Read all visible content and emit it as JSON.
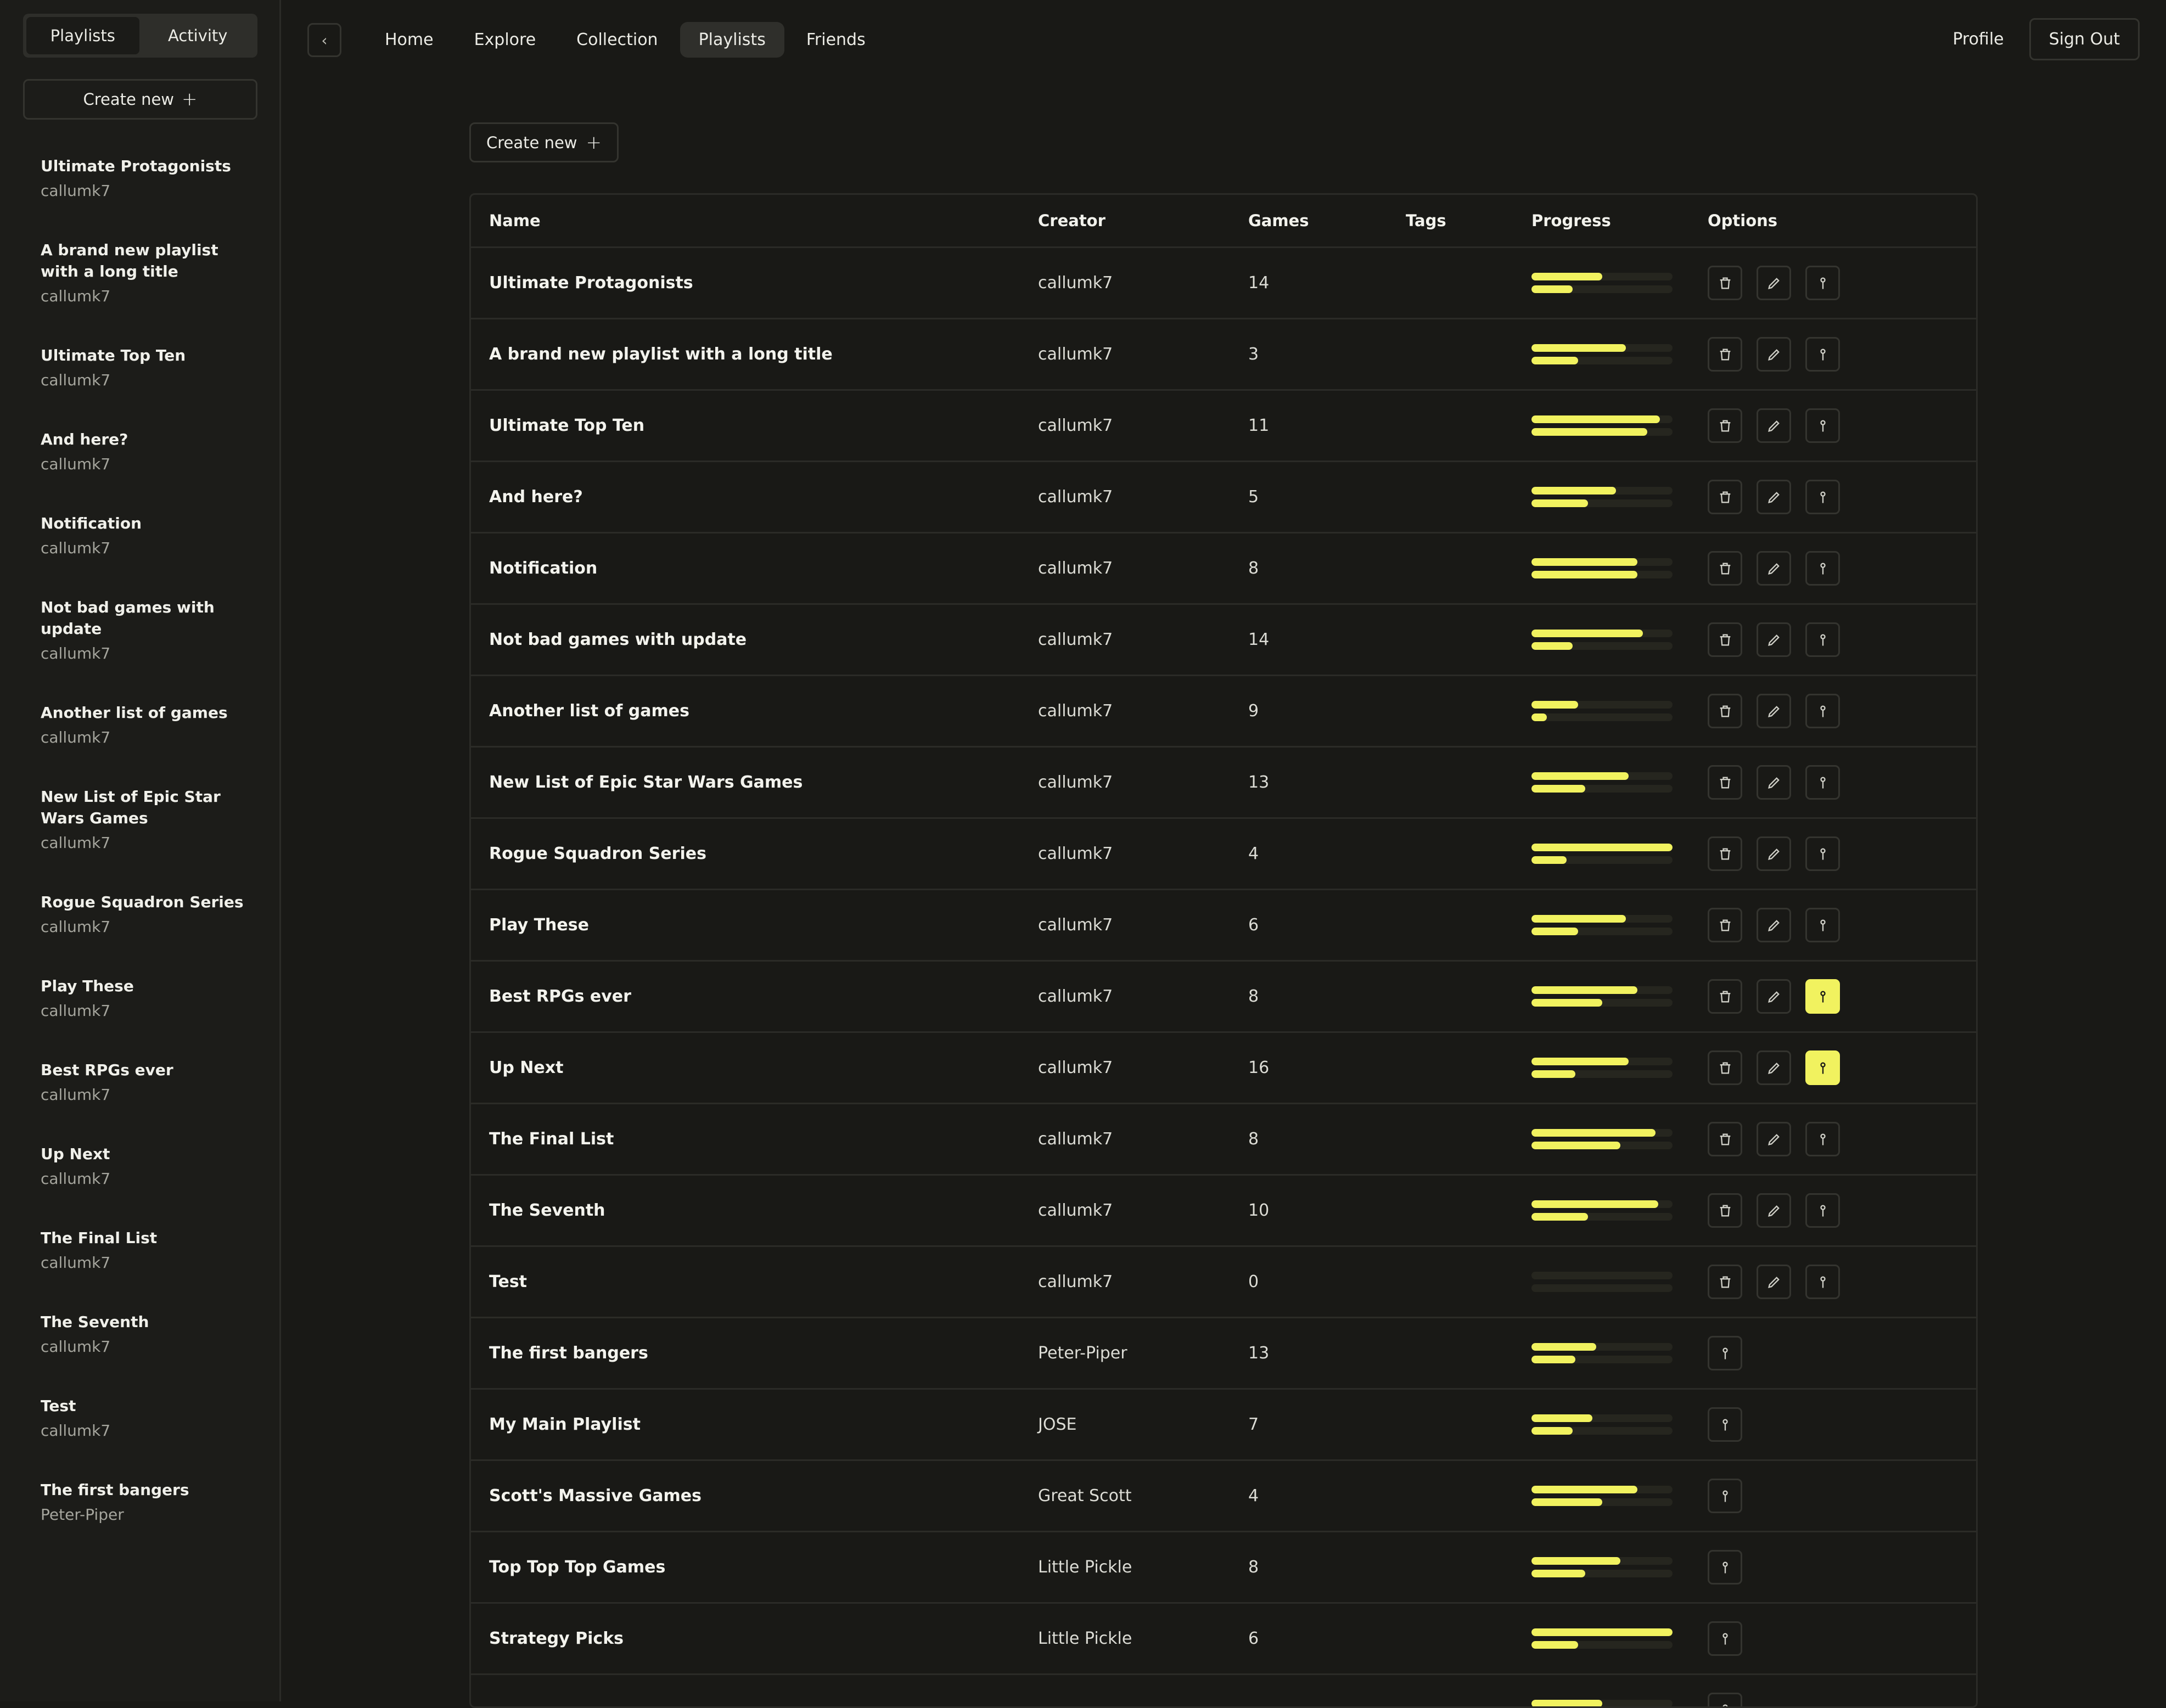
{
  "sidebar": {
    "tabs": [
      {
        "label": "Playlists",
        "active": true
      },
      {
        "label": "Activity",
        "active": false
      }
    ],
    "create_label": "Create new",
    "items": [
      {
        "title": "Ultimate Protagonists",
        "creator": "callumk7"
      },
      {
        "title": "A brand new playlist with a long title",
        "creator": "callumk7"
      },
      {
        "title": "Ultimate Top Ten",
        "creator": "callumk7"
      },
      {
        "title": "And here?",
        "creator": "callumk7"
      },
      {
        "title": "Notification",
        "creator": "callumk7"
      },
      {
        "title": "Not bad games with update",
        "creator": "callumk7"
      },
      {
        "title": "Another list of games",
        "creator": "callumk7"
      },
      {
        "title": "New List of Epic Star Wars Games",
        "creator": "callumk7"
      },
      {
        "title": "Rogue Squadron Series",
        "creator": "callumk7"
      },
      {
        "title": "Play These",
        "creator": "callumk7"
      },
      {
        "title": "Best RPGs ever",
        "creator": "callumk7"
      },
      {
        "title": "Up Next",
        "creator": "callumk7"
      },
      {
        "title": "The Final List",
        "creator": "callumk7"
      },
      {
        "title": "The Seventh",
        "creator": "callumk7"
      },
      {
        "title": "Test",
        "creator": "callumk7"
      },
      {
        "title": "The first bangers",
        "creator": "Peter-Piper"
      }
    ]
  },
  "nav": {
    "links": [
      {
        "label": "Home",
        "active": false
      },
      {
        "label": "Explore",
        "active": false
      },
      {
        "label": "Collection",
        "active": false
      },
      {
        "label": "Playlists",
        "active": true
      },
      {
        "label": "Friends",
        "active": false
      }
    ],
    "profile_label": "Profile",
    "signout_label": "Sign Out"
  },
  "main": {
    "create_label": "Create new",
    "table": {
      "headers": {
        "name": "Name",
        "creator": "Creator",
        "games": "Games",
        "tags": "Tags",
        "progress": "Progress",
        "options": "Options"
      },
      "rows": [
        {
          "name": "Ultimate Protagonists",
          "creator": "callumk7",
          "games": "14",
          "tags": "",
          "progress": [
            0.5,
            0.29
          ],
          "owned": true,
          "pinned": false
        },
        {
          "name": "A brand new playlist with a long title",
          "creator": "callumk7",
          "games": "3",
          "tags": "",
          "progress": [
            0.67,
            0.33
          ],
          "owned": true,
          "pinned": false
        },
        {
          "name": "Ultimate Top Ten",
          "creator": "callumk7",
          "games": "11",
          "tags": "",
          "progress": [
            0.91,
            0.82
          ],
          "owned": true,
          "pinned": false
        },
        {
          "name": "And here?",
          "creator": "callumk7",
          "games": "5",
          "tags": "",
          "progress": [
            0.6,
            0.4
          ],
          "owned": true,
          "pinned": false
        },
        {
          "name": "Notification",
          "creator": "callumk7",
          "games": "8",
          "tags": "",
          "progress": [
            0.75,
            0.75
          ],
          "owned": true,
          "pinned": false
        },
        {
          "name": "Not bad games with update",
          "creator": "callumk7",
          "games": "14",
          "tags": "",
          "progress": [
            0.79,
            0.29
          ],
          "owned": true,
          "pinned": false
        },
        {
          "name": "Another list of games",
          "creator": "callumk7",
          "games": "9",
          "tags": "",
          "progress": [
            0.33,
            0.11
          ],
          "owned": true,
          "pinned": false
        },
        {
          "name": "New List of Epic Star Wars Games",
          "creator": "callumk7",
          "games": "13",
          "tags": "",
          "progress": [
            0.69,
            0.38
          ],
          "owned": true,
          "pinned": false
        },
        {
          "name": "Rogue Squadron Series",
          "creator": "callumk7",
          "games": "4",
          "tags": "",
          "progress": [
            1.0,
            0.25
          ],
          "owned": true,
          "pinned": false
        },
        {
          "name": "Play These",
          "creator": "callumk7",
          "games": "6",
          "tags": "",
          "progress": [
            0.67,
            0.33
          ],
          "owned": true,
          "pinned": false
        },
        {
          "name": "Best RPGs ever",
          "creator": "callumk7",
          "games": "8",
          "tags": "",
          "progress": [
            0.75,
            0.5
          ],
          "owned": true,
          "pinned": true
        },
        {
          "name": "Up Next",
          "creator": "callumk7",
          "games": "16",
          "tags": "",
          "progress": [
            0.69,
            0.31
          ],
          "owned": true,
          "pinned": true
        },
        {
          "name": "The Final List",
          "creator": "callumk7",
          "games": "8",
          "tags": "",
          "progress": [
            0.88,
            0.63
          ],
          "owned": true,
          "pinned": false
        },
        {
          "name": "The Seventh",
          "creator": "callumk7",
          "games": "10",
          "tags": "",
          "progress": [
            0.9,
            0.4
          ],
          "owned": true,
          "pinned": false
        },
        {
          "name": "Test",
          "creator": "callumk7",
          "games": "0",
          "tags": "",
          "progress": [
            0.0,
            0.0
          ],
          "owned": true,
          "pinned": false
        },
        {
          "name": "The first bangers",
          "creator": "Peter-Piper",
          "games": "13",
          "tags": "",
          "progress": [
            0.46,
            0.31
          ],
          "owned": false,
          "pinned": false
        },
        {
          "name": "My Main Playlist",
          "creator": "JOSE",
          "games": "7",
          "tags": "",
          "progress": [
            0.43,
            0.29
          ],
          "owned": false,
          "pinned": false
        },
        {
          "name": "Scott's Massive Games",
          "creator": "Great Scott",
          "games": "4",
          "tags": "",
          "progress": [
            0.75,
            0.5
          ],
          "owned": false,
          "pinned": false
        },
        {
          "name": "Top Top Top Games",
          "creator": "Little Pickle",
          "games": "8",
          "tags": "",
          "progress": [
            0.63,
            0.38
          ],
          "owned": false,
          "pinned": false
        },
        {
          "name": "Strategy Picks",
          "creator": "Little Pickle",
          "games": "6",
          "tags": "",
          "progress": [
            1.0,
            0.33
          ],
          "owned": false,
          "pinned": false
        },
        {
          "name": "",
          "creator": "",
          "games": "",
          "tags": "",
          "progress": [
            0.5,
            0.0
          ],
          "owned": false,
          "pinned": false
        }
      ]
    }
  },
  "icons": {
    "back": "chevron-left-icon",
    "delete": "trash-icon",
    "edit": "pencil-icon",
    "pin": "pin-icon",
    "add": "plus-icon"
  },
  "colors": {
    "background": "#191916",
    "sidebar": "#1c1c19",
    "accent": "#f1f25f",
    "border": "#2b2b27",
    "muted_text": "#a5a59d"
  }
}
